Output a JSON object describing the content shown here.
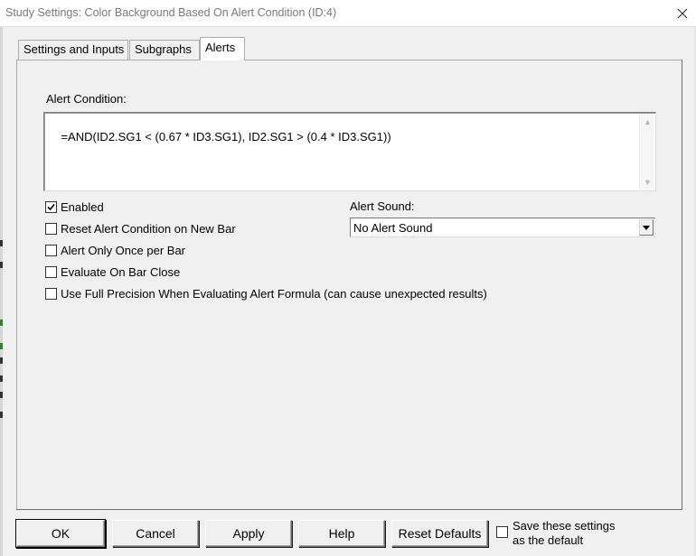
{
  "window": {
    "title": "Study Settings: Color Background Based On Alert Condition (ID:4)",
    "close_icon": "close-icon"
  },
  "tabs": [
    {
      "label": "Settings and Inputs",
      "active": false
    },
    {
      "label": "Subgraphs",
      "active": false
    },
    {
      "label": "Alerts",
      "active": true
    }
  ],
  "alerts": {
    "condition_label": "Alert Condition:",
    "condition_value": "=AND(ID2.SG1 < (0.67 * ID3.SG1), ID2.SG1 > (0.4 * ID3.SG1))",
    "checkboxes": [
      {
        "label": "Enabled",
        "checked": true
      },
      {
        "label": "Reset Alert Condition on New Bar",
        "checked": false
      },
      {
        "label": "Alert Only Once per Bar",
        "checked": false
      },
      {
        "label": "Evaluate On Bar Close",
        "checked": false
      },
      {
        "label": "Use Full Precision When Evaluating Alert Formula (can cause unexpected results)",
        "checked": false
      }
    ],
    "sound_label": "Alert Sound:",
    "sound_value": "No Alert Sound"
  },
  "buttons": {
    "ok": "OK",
    "cancel": "Cancel",
    "apply": "Apply",
    "help": "Help",
    "reset_defaults": "Reset Defaults"
  },
  "save_default": {
    "label_line1": "Save these settings",
    "label_line2": "as the default",
    "checked": false
  }
}
